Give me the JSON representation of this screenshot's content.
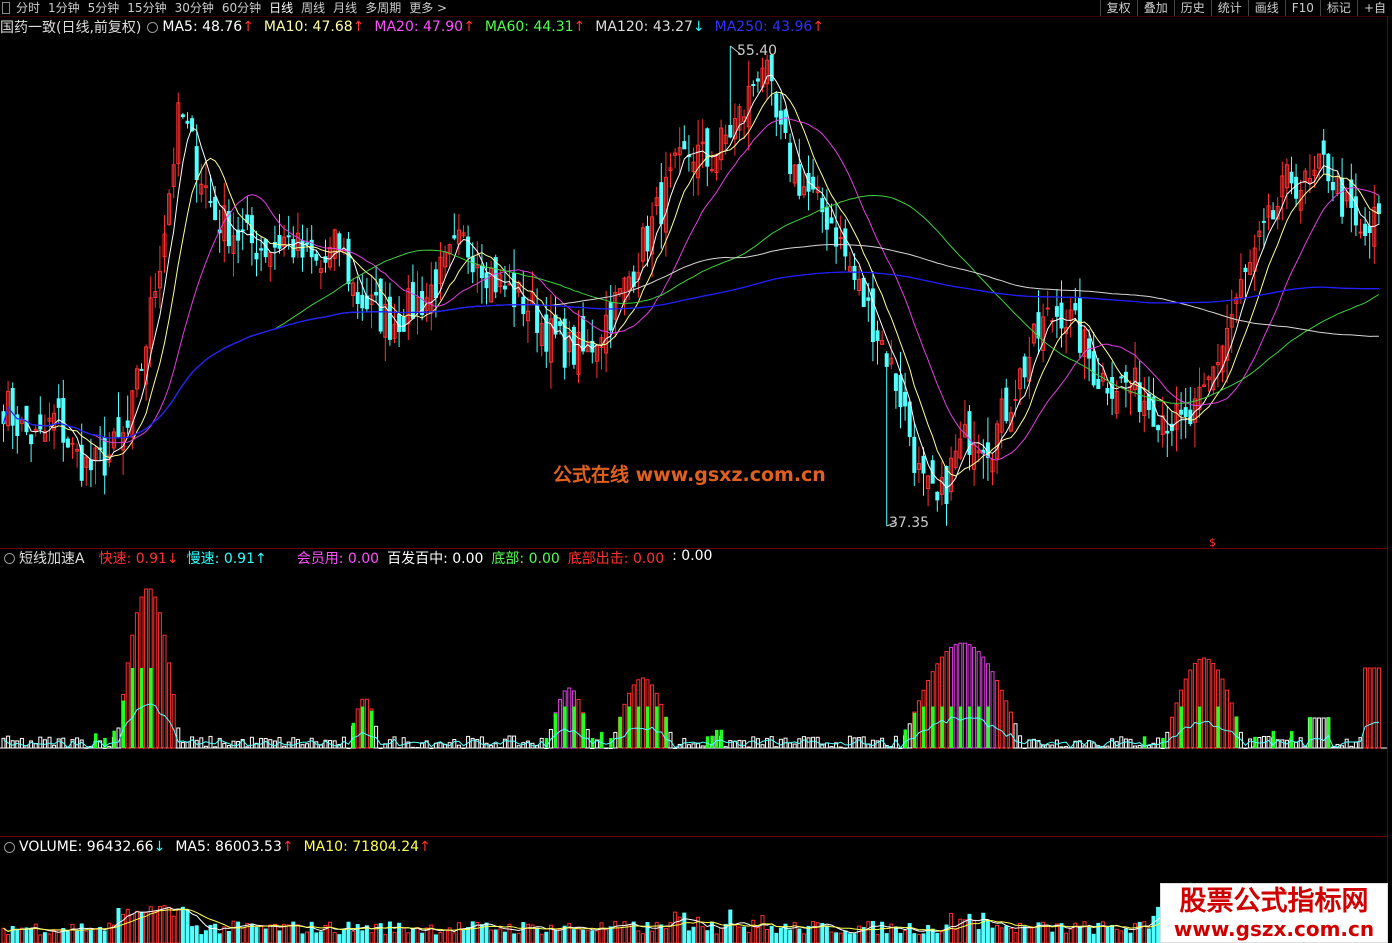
{
  "toolbar": {
    "timeframes": [
      "分时",
      "1分钟",
      "5分钟",
      "15分钟",
      "30分钟",
      "60分钟",
      "日线",
      "周线",
      "月线",
      "多周期",
      "更多 >"
    ],
    "active": "日线",
    "right_buttons": [
      "复权",
      "叠加",
      "历史",
      "统计",
      "画线",
      "F10",
      "标记",
      "+自"
    ]
  },
  "main": {
    "title": "国药一致(日线,前复权)",
    "ma": [
      {
        "label": "MA5: 48.76",
        "arrow": "↑",
        "color": "#ffffff",
        "arrow_color": "#ff3030"
      },
      {
        "label": "MA10: 47.68",
        "arrow": "↑",
        "color": "#ffffaa",
        "arrow_color": "#ff3030"
      },
      {
        "label": "MA20: 47.90",
        "arrow": "↑",
        "color": "#ff50ff",
        "arrow_color": "#ff3030"
      },
      {
        "label": "MA60: 44.31",
        "arrow": "↑",
        "color": "#50ff50",
        "arrow_color": "#ff3030"
      },
      {
        "label": "MA120: 43.27",
        "arrow": "↓",
        "color": "#dddddd",
        "arrow_color": "#30ffff"
      },
      {
        "label": "MA250: 43.96",
        "arrow": "↑",
        "color": "#3030ff",
        "arrow_color": "#ff3030"
      }
    ],
    "high_label": "55.40",
    "low_label": "37.35",
    "watermark": "公式在线  www.gsxz.com.cn",
    "marker": "$"
  },
  "indicator": {
    "name": "短线加速A",
    "fields": [
      {
        "label": "快速: ",
        "value": "0.91",
        "arrow": "↓",
        "color": "#ff3030"
      },
      {
        "label": "慢速: ",
        "value": "0.91",
        "arrow": "↑",
        "color": "#30ffff"
      },
      {
        "label": "会员用: ",
        "value": "0.00",
        "arrow": "",
        "color": "#ff50ff"
      },
      {
        "label": "百发百中: ",
        "value": "0.00",
        "arrow": "",
        "color": "#ffffff"
      },
      {
        "label": "底部: ",
        "value": "0.00",
        "arrow": "",
        "color": "#50ff50"
      },
      {
        "label": "底部出击: ",
        "value": "0.00",
        "arrow": "",
        "color": "#ff3030"
      },
      {
        "label": ": ",
        "value": "0.00",
        "arrow": "",
        "color": "#ffffff"
      }
    ]
  },
  "volume": {
    "fields": [
      {
        "label": "VOLUME: 96432.66",
        "arrow": "↓",
        "color": "#ffffff",
        "arrow_color": "#30ffff"
      },
      {
        "label": "MA5: 86003.53",
        "arrow": "↑",
        "color": "#ffffff",
        "arrow_color": "#ff3030"
      },
      {
        "label": "MA10: 71804.24",
        "arrow": "↑",
        "color": "#ffff50",
        "arrow_color": "#ff3030"
      }
    ]
  },
  "logo": {
    "line1": "股票公式指标网",
    "line2": "www.gszx.com.cn"
  },
  "colors": {
    "up": "#ff3030",
    "down": "#54ffff",
    "ma5": "#ffffff",
    "ma10": "#ffff99",
    "ma20": "#e040e0",
    "ma60": "#40d040",
    "ma120": "#d8d8d8",
    "ma250": "#2020ff"
  },
  "chart_data": {
    "type": "candlestick",
    "price_range": [
      37.35,
      55.4
    ],
    "close_approx": [
      42,
      41,
      40.5,
      41.5,
      40,
      39.5,
      40,
      40.8,
      44,
      48,
      53,
      51,
      49,
      48.5,
      48,
      47.8,
      48.2,
      47.5,
      47,
      48,
      46,
      45.5,
      45,
      45.5,
      46,
      47,
      48,
      47.5,
      46.5,
      46,
      45.5,
      44.5,
      44,
      43.8,
      45,
      46,
      47.5,
      49,
      50.5,
      51.5,
      51,
      52,
      53,
      55,
      52,
      50.5,
      49.5,
      48.8,
      47,
      45.5,
      44,
      42,
      39,
      38,
      40,
      41,
      40.5,
      42,
      43.5,
      45,
      45.5,
      44.5,
      43,
      42.8,
      42.6,
      42,
      41.5,
      41,
      42,
      44,
      46,
      47.5,
      49,
      50.5,
      50,
      51,
      49.5,
      48,
      49
    ]
  }
}
